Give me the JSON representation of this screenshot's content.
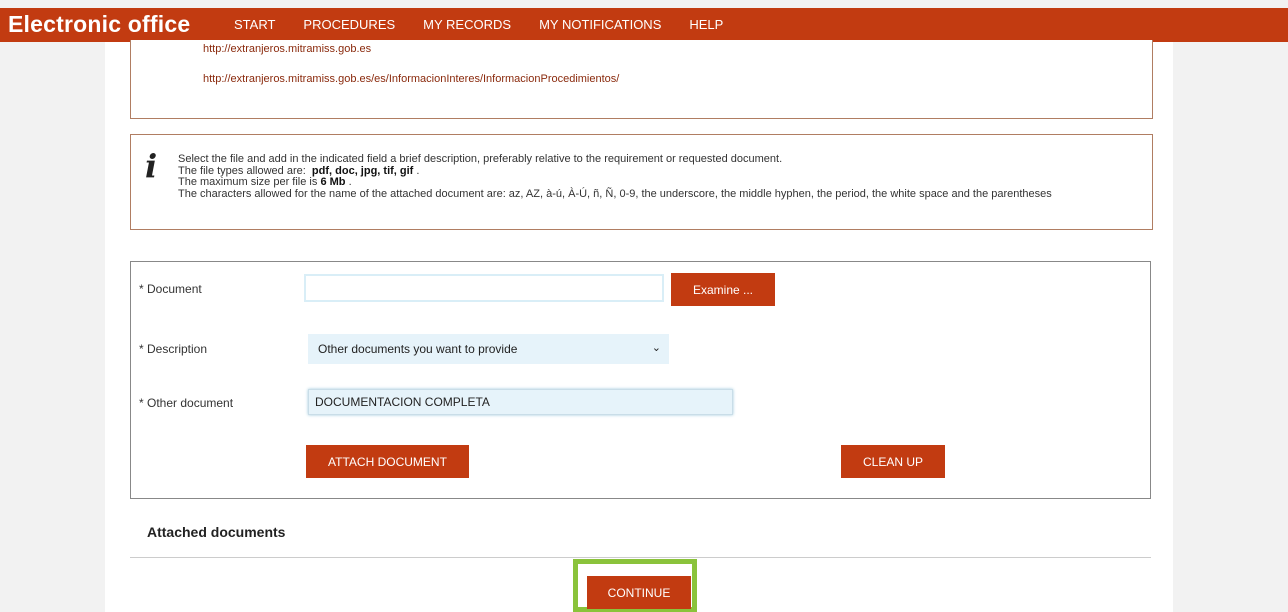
{
  "header": {
    "brand": "Electronic office",
    "nav": [
      "START",
      "PROCEDURES",
      "MY RECORDS",
      "MY NOTIFICATIONS",
      "HELP"
    ],
    "color": "#c23b11"
  },
  "links": [
    "http://extranjeros.mitramiss.gob.es",
    "http://extranjeros.mitramiss.gob.es/es/InformacionInteres/InformacionProcedimientos/"
  ],
  "info": {
    "icon": "info-icon",
    "line1": "Select the file and add in the indicated field a brief description, preferably relative to the requirement or requested document.",
    "line2_prefix": "The file types allowed are:",
    "line2_types": "pdf, doc, jpg, tif, gif",
    "line2_suffix": ".",
    "line3_prefix": "The maximum size per file is",
    "line3_size": "6 Mb",
    "line3_suffix": ".",
    "line4": "The characters allowed for the name of the attached document are: az, AZ, à-ú, À-Ú, ñ, Ñ, 0-9, the underscore, the middle hyphen, the period, the white space and the parentheses"
  },
  "form": {
    "document_label": "* Document",
    "document_value": "",
    "examine_label": "Examine ...",
    "description_label": "* Description",
    "description_value": "Other documents you want to provide",
    "other_label": "* Other document",
    "other_value": "DOCUMENTACION COMPLETA",
    "attach_label": "ATTACH DOCUMENT",
    "cleanup_label": "CLEAN UP"
  },
  "attached_title": "Attached documents",
  "continue_label": "CONTINUE",
  "highlight_color": "#8ac33b"
}
